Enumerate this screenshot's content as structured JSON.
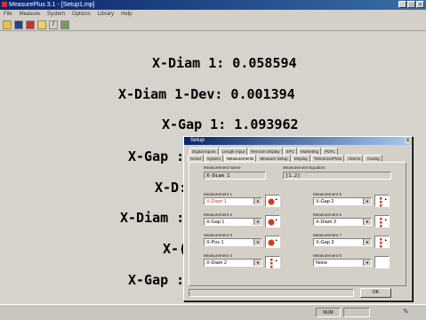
{
  "window": {
    "title": "MeasurePlus 3.1 - [Setup1.mp]",
    "controls": [
      "_",
      "□",
      "×"
    ]
  },
  "menu": [
    "File",
    "Measure",
    "System",
    "Options",
    "Library",
    "Help"
  ],
  "readings": [
    {
      "text": "X-Diam 1: 0.058594"
    },
    {
      "text": "X-Diam 1-Dev: 0.001394"
    },
    {
      "text": "X-Gap 1: 1.093962"
    },
    {
      "text": "X-Gap :"
    },
    {
      "text": "X-D:"
    },
    {
      "text": "X-Diam :"
    },
    {
      "text": "X-("
    },
    {
      "text": "X-Gap :"
    }
  ],
  "statusbar": {
    "mode": "NUM"
  },
  "dialog": {
    "title": "Setup",
    "close": "x",
    "tabs_row1": [
      "Digital Inputs",
      "Length Input",
      "Remote Display",
      "SPC",
      "Marketing",
      "PDFL"
    ],
    "tabs_row2": [
      "Serial",
      "System",
      "Measurements",
      "Measure Setup",
      "Display",
      "Tolerance/Plots",
      "Alarms",
      "Analog"
    ],
    "measurement_name_label": "Measurement Name",
    "measurement_name_value": "X-Diam 1",
    "measurement_equation_label": "Measurement Equation",
    "measurement_equation_value": "[1.2]",
    "measurements": [
      {
        "label": "Measurement 1",
        "value": "X-Diam 1",
        "color": "#d13c1b"
      },
      {
        "label": "Measurement 2",
        "value": "X-Gap 1",
        "color": "#d13c1b"
      },
      {
        "label": "Measurement 3",
        "value": "X-Pos 1",
        "color": "#d13c1b"
      },
      {
        "label": "Measurement 4",
        "value": "X-Diam 2",
        "color": "#d13c1b"
      },
      {
        "label": "Measurement 5",
        "value": "X-Gap 2",
        "color": "#d13c1b"
      },
      {
        "label": "Measurement 6",
        "value": "X-Diam 3",
        "color": "#d13c1b"
      },
      {
        "label": "Measurement 7",
        "value": "X-Gap 3",
        "color": "#d13c1b"
      },
      {
        "label": "Measurement 8",
        "value": "None",
        "color": "#ffffff"
      }
    ],
    "ok_label": "OK"
  }
}
